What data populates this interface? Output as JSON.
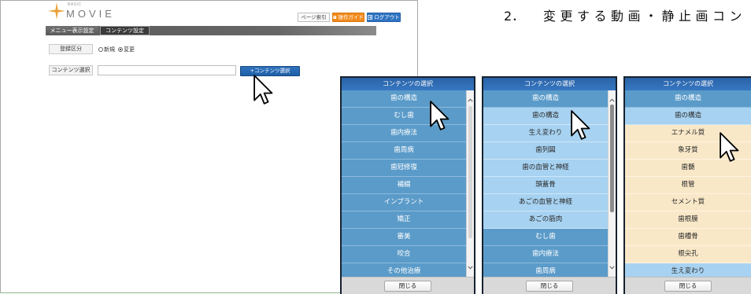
{
  "app": {
    "logo": {
      "small_text": "BASIC",
      "title": "MOVIE"
    },
    "header_buttons": {
      "page_index": "ページ索引",
      "guide": "操作ガイド",
      "logout": "ログアウト"
    },
    "nav": {
      "tabs": [
        {
          "label": "メニュー表示設定"
        },
        {
          "label": "コンテンツ設定"
        }
      ]
    },
    "form": {
      "registration_label": "登録区分",
      "registration_options": [
        {
          "label": "新規",
          "checked": false
        },
        {
          "label": "変更",
          "checked": true
        }
      ],
      "content_label": "コンテンツ選択",
      "content_input_value": "",
      "content_button": "+コンテンツ選択"
    }
  },
  "instruction": {
    "number": "2．",
    "text": "変更する動画・静止画コン"
  },
  "popups": [
    {
      "title": "コンテンツの選択",
      "items": [
        "歯の構造",
        "むし歯",
        "歯内療法",
        "歯周病",
        "歯冠修復",
        "補綴",
        "インプラント",
        "矯正",
        "審美",
        "咬合",
        "その他治療"
      ],
      "close_label": "閉じる"
    },
    {
      "title": "コンテンツの選択",
      "items": [
        "歯の構造",
        "歯の構造",
        "生え変わり",
        "歯列図",
        "歯の血管と神経",
        "頭蓋骨",
        "あごの血管と神経",
        "あごの筋肉",
        "むし歯",
        "歯内療法",
        "歯周病"
      ],
      "close_label": "閉じる"
    },
    {
      "title": "コンテンツの選択",
      "items": [
        "歯の構造",
        "歯の構造",
        "エナメル質",
        "象牙質",
        "歯髄",
        "根管",
        "セメント質",
        "歯根膜",
        "歯槽骨",
        "根尖孔",
        "生え変わり"
      ],
      "close_label": "閉じる"
    }
  ],
  "colors": {
    "popup_header": "#3677c2",
    "category_item": "#5b9bc9",
    "subcategory_item": "#a7d2f1",
    "topic_item": "#f9e8c8",
    "guide_button": "#f08a1c",
    "logout_button": "#2f74c2",
    "select_button": "#1f5fa7"
  }
}
